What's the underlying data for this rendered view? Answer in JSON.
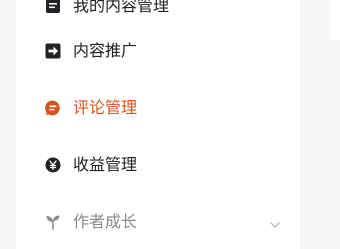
{
  "sidebar": {
    "items": [
      {
        "label": "我的内容管理",
        "icon": "document-icon",
        "state": "normal"
      },
      {
        "label": "内容推广",
        "icon": "arrow-right-square-icon",
        "state": "normal"
      },
      {
        "label": "评论管理",
        "icon": "comment-bubble-icon",
        "state": "active"
      },
      {
        "label": "收益管理",
        "icon": "yuan-coin-icon",
        "state": "normal"
      },
      {
        "label": "作者成长",
        "icon": "sprout-icon",
        "state": "disabled",
        "expandable": true
      }
    ]
  },
  "colors": {
    "active": "#d9531e",
    "text": "#222226",
    "muted": "#8a8a90",
    "background": "#f5f6f7"
  }
}
